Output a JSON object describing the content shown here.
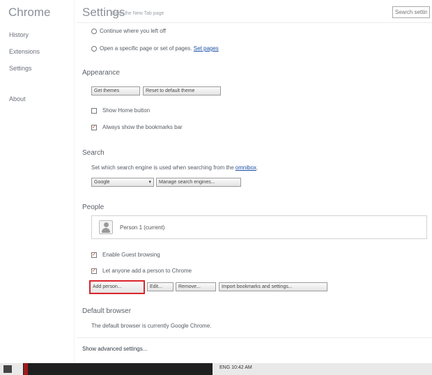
{
  "sidebar": {
    "brand": "Chrome",
    "items": [
      {
        "label": "History"
      },
      {
        "label": "Extensions"
      },
      {
        "label": "Settings"
      },
      {
        "label": "About"
      }
    ]
  },
  "header": {
    "title": "Settings",
    "ntp_hint": "Open the New Tab page",
    "search_placeholder": "Search settings"
  },
  "on_startup": {
    "continue": "Continue where you left off",
    "specific": "Open a specific page or set of pages.",
    "set_pages_link": "Set pages"
  },
  "appearance": {
    "heading": "Appearance",
    "get_themes": "Get themes",
    "reset_theme": "Reset to default theme",
    "show_home": "Show Home button",
    "bookmarks_bar": "Always show the bookmarks bar"
  },
  "search": {
    "heading": "Search",
    "description": "Set which search engine is used when searching from the",
    "omnibox_link": "omnibox",
    "engine_select": "Google",
    "manage_engines": "Manage search engines..."
  },
  "people": {
    "heading": "People",
    "profile_name": "Person 1 (current)",
    "guest": "Enable Guest browsing",
    "add_person": "Let anyone add a person to Chrome",
    "buttons": {
      "add": "Add person...",
      "edit": "Edit...",
      "remove": "Remove...",
      "import": "Import bookmarks and settings..."
    }
  },
  "default_browser": {
    "heading": "Default browser",
    "text": "The default browser is currently Google Chrome."
  },
  "advanced_link": "Show advanced settings...",
  "taskbar": {
    "tray_text": "ENG  10:42 AM"
  },
  "colors": {
    "selection_red": "#d9242b",
    "link_blue": "#1a4fa5"
  }
}
